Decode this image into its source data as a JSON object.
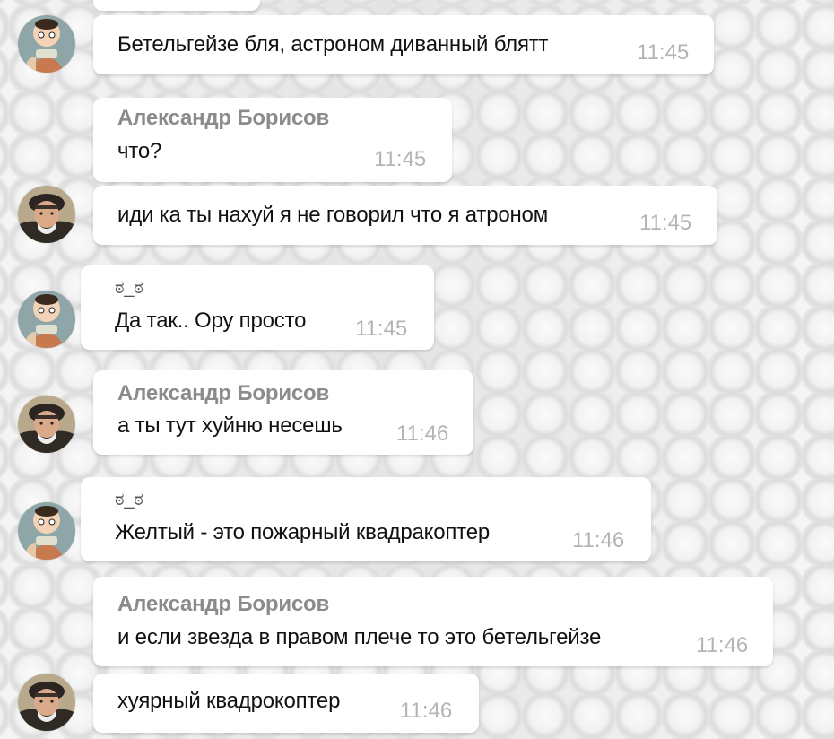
{
  "messages": [
    {
      "avatar": "cartoon-avatar",
      "author": "",
      "text": "Бетельгейзе бля, астроном диванный блятт",
      "time": "11:45"
    },
    {
      "avatar": "",
      "author": "Александр Борисов",
      "text": "что?",
      "time": "11:45"
    },
    {
      "avatar": "photo-avatar",
      "author": "",
      "text": "иди ка ты нахуй я не говорил что я атроном",
      "time": "11:45"
    },
    {
      "avatar": "cartoon-avatar",
      "author": "ಠ_ಠ",
      "text": "Да так.. Ору просто",
      "time": "11:45"
    },
    {
      "avatar": "photo-avatar",
      "author": "Александр Борисов",
      "text": "а ты тут хуйню несешь",
      "time": "11:46"
    },
    {
      "avatar": "cartoon-avatar",
      "author": "ಠ_ಠ",
      "text": "Желтый - это пожарный квадракоптер",
      "time": "11:46"
    },
    {
      "avatar": "",
      "author": "Александр Борисов",
      "text": "и если звезда в правом плече то это бетельгейзе",
      "time": "11:46"
    },
    {
      "avatar": "photo-avatar",
      "author": "",
      "text": "хуярный квадрокоптер",
      "time": "11:46"
    }
  ],
  "colors": {
    "bubble": "#ffffff",
    "author": "#8b8b8b",
    "text": "#111111",
    "time": "#b4b4b4"
  }
}
